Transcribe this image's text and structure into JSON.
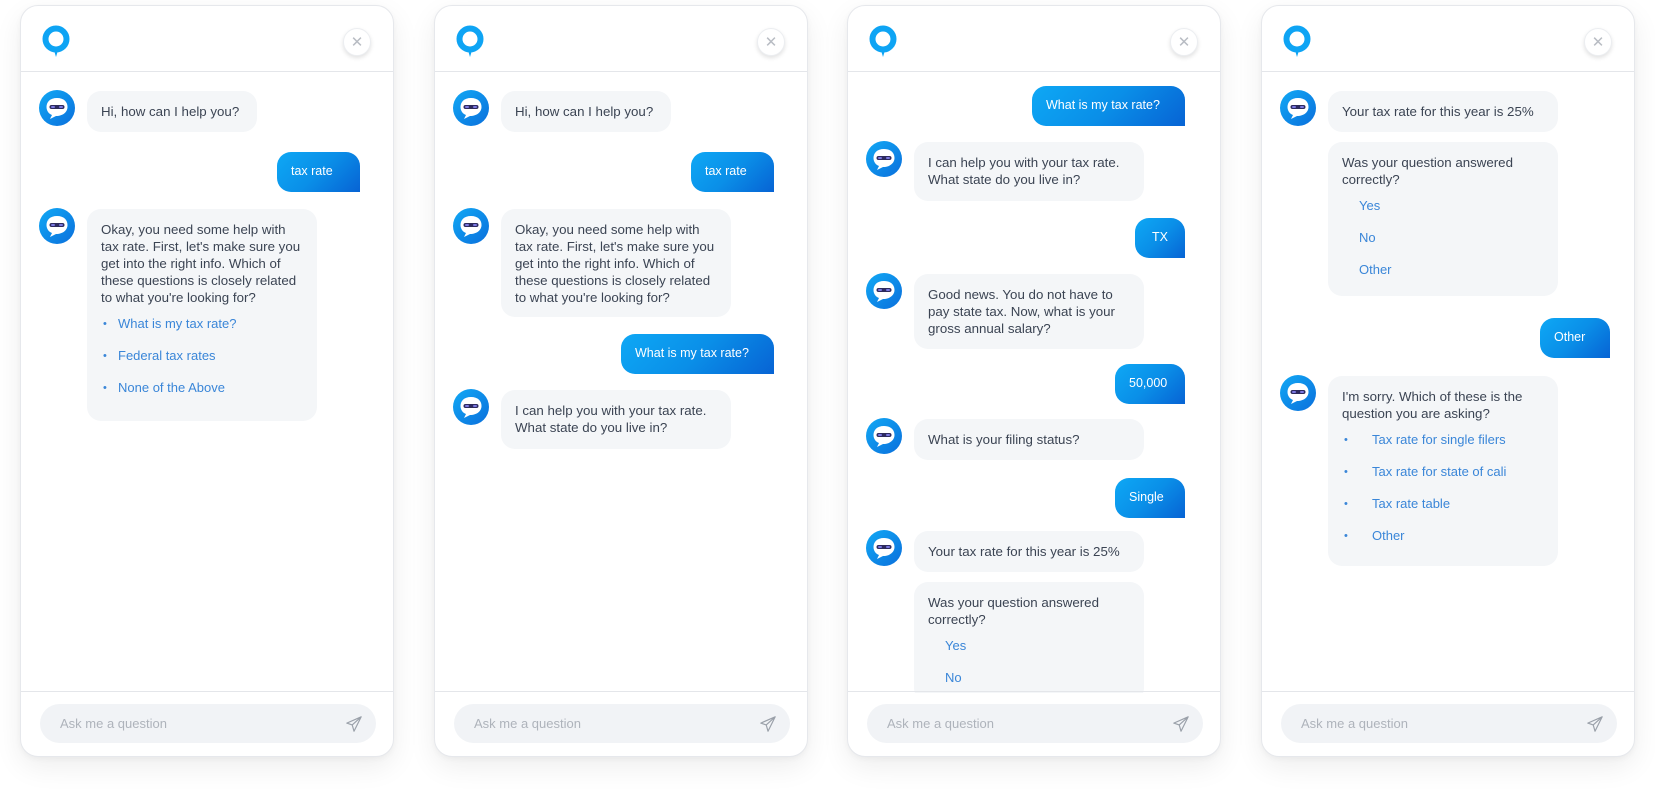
{
  "input": {
    "placeholder": "Ask me a question"
  },
  "colors": {
    "accent": "#0ea8f5",
    "accent_dark": "#0763d4",
    "link": "#3a86d8",
    "bot_bubble": "#f4f6f8",
    "text": "#3b4453"
  },
  "icons": {
    "logo": "chat-pin-logo-icon",
    "close": "close-icon",
    "avatar": "bot-avatar-icon",
    "send": "send-paper-plane-icon",
    "close_glyph": "✕",
    "bullet": "•"
  },
  "panels": [
    {
      "messages": [
        {
          "from": "bot",
          "text": "Hi, how can I help you?"
        },
        {
          "from": "user",
          "text": "tax rate"
        },
        {
          "from": "bot",
          "text": "Okay, you need some help with tax rate. First, let's make sure you get into the right info. Which of these questions is closely related to what you're looking for?",
          "options": [
            "What is my tax rate?",
            "Federal tax rates",
            "None of the Above"
          ]
        }
      ]
    },
    {
      "messages": [
        {
          "from": "bot",
          "text": "Hi, how can I help you?"
        },
        {
          "from": "user",
          "text": "tax rate"
        },
        {
          "from": "bot",
          "text": "Okay, you need some help with tax rate. First, let's make sure you get into the right info. Which of these questions is closely related to what you're looking for?"
        },
        {
          "from": "user",
          "text": "What is my tax rate?"
        },
        {
          "from": "bot",
          "text": "I can help you with your tax rate. What state do you live in?"
        }
      ]
    },
    {
      "messages": [
        {
          "from": "user",
          "text": "What is my tax rate?"
        },
        {
          "from": "bot",
          "text": "I can help you with your tax rate. What state do you live in?"
        },
        {
          "from": "user",
          "text": "TX"
        },
        {
          "from": "bot",
          "text": "Good news. You do not have to pay state tax. Now, what is your gross annual salary?"
        },
        {
          "from": "user",
          "text": "50,000"
        },
        {
          "from": "bot",
          "text": "What is your filing status?"
        },
        {
          "from": "user",
          "text": "Single"
        },
        {
          "from": "bot",
          "text": "Your tax rate for this year is 25%"
        },
        {
          "from": "bot",
          "text": "Was your question answered correctly?",
          "options": [
            "Yes",
            "No"
          ]
        }
      ]
    },
    {
      "messages": [
        {
          "from": "bot",
          "text": "Your tax rate for this year is 25%"
        },
        {
          "from": "bot",
          "text": "Was your question answered correctly?",
          "options": [
            "Yes",
            "No",
            "Other"
          ]
        },
        {
          "from": "user",
          "text": "Other"
        },
        {
          "from": "bot",
          "text": "I'm sorry. Which of these is the question you are asking?",
          "options": [
            "Tax rate for single filers",
            "Tax rate for state of cali",
            "Tax rate table",
            "Other"
          ]
        }
      ]
    }
  ]
}
